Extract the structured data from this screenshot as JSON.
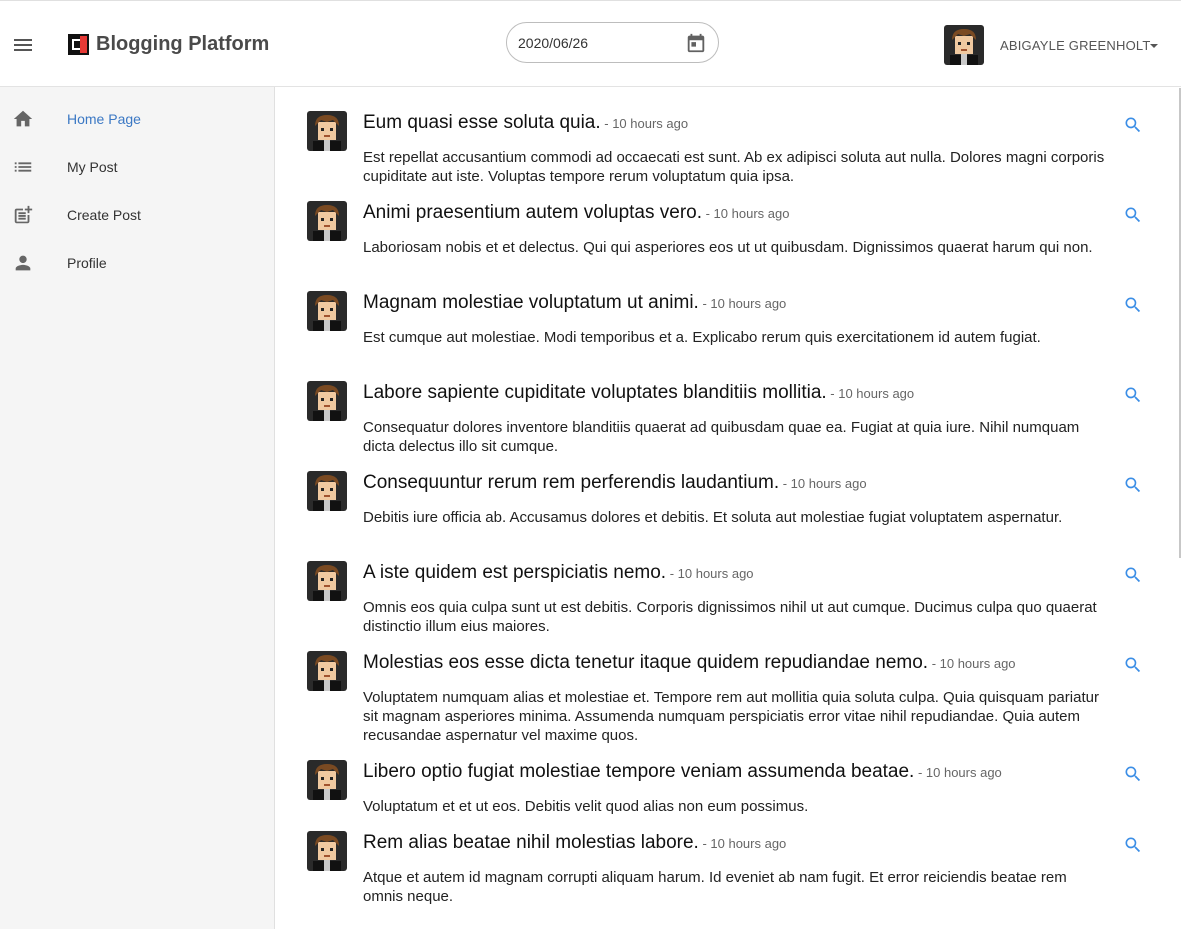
{
  "app": {
    "title": "Blogging Platform"
  },
  "header": {
    "date_value": "2020/06/26",
    "user_name": "ABIGAYLE GREENHOLT"
  },
  "colors": {
    "accent": "#3b78c4",
    "search": "#3b8ee6",
    "logo_red": "#e53935"
  },
  "sidebar": {
    "items": [
      {
        "label": "Home Page",
        "icon": "home-icon",
        "active": true
      },
      {
        "label": "My Post",
        "icon": "list-icon",
        "active": false
      },
      {
        "label": "Create Post",
        "icon": "post-add-icon",
        "active": false
      },
      {
        "label": "Profile",
        "icon": "person-icon",
        "active": false
      }
    ]
  },
  "posts": [
    {
      "title": "Eum quasi esse soluta quia.",
      "time": " - 10 hours ago",
      "body": "Est repellat accusantium commodi ad occaecati est sunt. Ab ex adipisci soluta aut nulla. Dolores magni corporis cupiditate aut iste. Voluptas tempore rerum voluptatum quia ipsa."
    },
    {
      "title": "Animi praesentium autem voluptas vero.",
      "time": " - 10 hours ago",
      "body": "Laboriosam nobis et et delectus. Qui qui asperiores eos ut ut quibusdam. Dignissimos quaerat harum qui non."
    },
    {
      "title": "Magnam molestiae voluptatum ut animi.",
      "time": " - 10 hours ago",
      "body": "Est cumque aut molestiae. Modi temporibus et a. Explicabo rerum quis exercitationem id autem fugiat."
    },
    {
      "title": "Labore sapiente cupiditate voluptates blanditiis mollitia.",
      "time": " - 10 hours ago",
      "body": "Consequatur dolores inventore blanditiis quaerat ad quibusdam quae ea. Fugiat at quia iure. Nihil numquam dicta delectus illo sit cumque."
    },
    {
      "title": "Consequuntur rerum rem perferendis laudantium.",
      "time": " - 10 hours ago",
      "body": "Debitis iure officia ab. Accusamus dolores et debitis. Et soluta aut molestiae fugiat voluptatem aspernatur."
    },
    {
      "title": "A iste quidem est perspiciatis nemo.",
      "time": " - 10 hours ago",
      "body": "Omnis eos quia culpa sunt ut est debitis. Corporis dignissimos nihil ut aut cumque. Ducimus culpa quo quaerat distinctio illum eius maiores."
    },
    {
      "title": "Molestias eos esse dicta tenetur itaque quidem repudiandae nemo.",
      "time": " - 10 hours ago",
      "body": "Voluptatem numquam alias et molestiae et. Tempore rem aut mollitia quia soluta culpa. Quia quisquam pariatur sit magnam asperiores minima. Assumenda numquam perspiciatis error vitae nihil repudiandae. Quia autem recusandae aspernatur vel maxime quos."
    },
    {
      "title": "Libero optio fugiat molestiae tempore veniam assumenda beatae.",
      "time": " - 10 hours ago",
      "body": "Voluptatum et et ut eos. Debitis velit quod alias non eum possimus."
    },
    {
      "title": "Rem alias beatae nihil molestias labore.",
      "time": " - 10 hours ago",
      "body": "Atque et autem id magnam corrupti aliquam harum. Id eveniet ab nam fugit. Et error reiciendis beatae rem omnis neque."
    }
  ]
}
